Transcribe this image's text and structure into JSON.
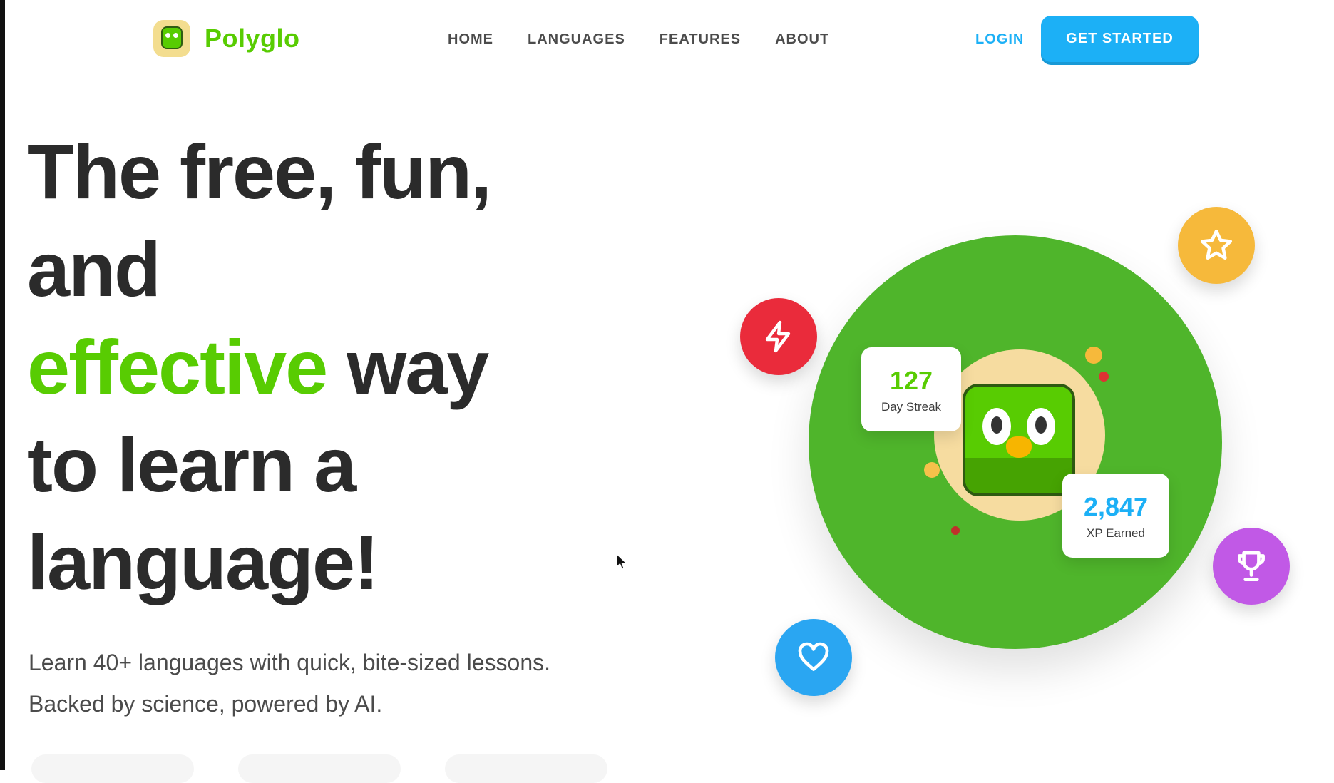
{
  "brand": {
    "name": "Polyglo",
    "logo_icon": "owl-mascot-icon"
  },
  "nav": {
    "links": [
      "HOME",
      "LANGUAGES",
      "FEATURES",
      "ABOUT"
    ],
    "login_label": "LOGIN",
    "cta_label": "GET STARTED"
  },
  "hero": {
    "headline": {
      "line1": "The free, fun,",
      "line2": "and",
      "line3_highlight": "effective",
      "line3_rest": " way",
      "line4": "to learn a",
      "line5": "language!"
    },
    "sub_line1": "Learn 40+ languages with quick, bite-sized lessons.",
    "sub_line2": "Backed by science, powered by AI.",
    "stats": {
      "streak_value": "127",
      "streak_label": "Day Streak",
      "xp_value": "2,847",
      "xp_label": "XP Earned"
    },
    "badges": [
      "bolt-icon",
      "star-icon",
      "trophy-icon",
      "heart-icon"
    ]
  },
  "colors": {
    "brand_green": "#58cc02",
    "circle_green": "#4fb52b",
    "blue": "#1cb0f6",
    "red": "#ea2b3b",
    "yellow": "#f6b93b",
    "purple": "#c159e6",
    "text_dark": "#2b2b2b"
  }
}
